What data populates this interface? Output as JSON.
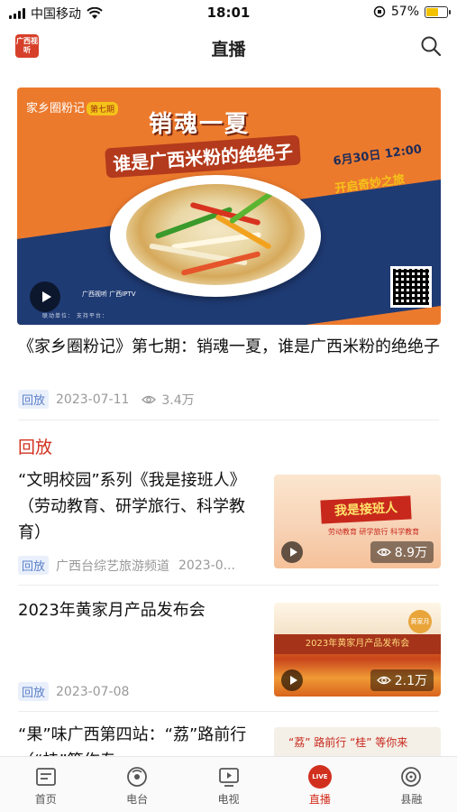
{
  "status_bar": {
    "carrier": "中国移动",
    "time": "18:01",
    "battery_percent": "57%",
    "battery_level": 0.57,
    "battery_color": "#f2c200"
  },
  "header": {
    "title": "直播",
    "logo_text": "广西视听",
    "search_icon": "search-icon"
  },
  "featured": {
    "brand": "家乡圈粉记",
    "episode": "第七期",
    "headline": "销魂一夏",
    "subheadline": "谁是广西米粉的绝绝子",
    "date": "6月30日 12:00",
    "tagline": "开启奇妙之旅",
    "logos": "广西视听  广西IPTV",
    "partners": "联动单位：   支持平台：",
    "title": "《家乡圈粉记》第七期：销魂一夏，谁是广西米粉的绝绝子",
    "badge": "回放",
    "date_published": "2023-07-11",
    "views": "3.4万"
  },
  "section_title": "回放",
  "items": [
    {
      "title": "“文明校园”系列《我是接班人》（劳动教育、研学旅行、科学教育）",
      "badge": "回放",
      "source": "广西台综艺旅游频道",
      "date": "2023-0...",
      "views": "8.9万",
      "thumb_text": "我是接班人",
      "thumb_sub": "劳动教育 研学旅行 科学教育"
    },
    {
      "title": "2023年黄家月产品发布会",
      "badge": "回放",
      "date": "2023-07-08",
      "views": "2.1万",
      "thumb_text": "2023年黄家月产品发布会",
      "thumb_stamp": "黄家月"
    },
    {
      "title": "“果”味广西第四站：“荔”路前行（“桂”等作专",
      "thumb_text": "“荔” 路前行 “桂” 等你来"
    }
  ],
  "tabbar": {
    "tabs": [
      {
        "label": "首页",
        "icon": "home-icon"
      },
      {
        "label": "电台",
        "icon": "radio-icon"
      },
      {
        "label": "电视",
        "icon": "tv-icon"
      },
      {
        "label": "直播",
        "icon": "live-icon",
        "icon_text": "LIVE"
      },
      {
        "label": "县融",
        "icon": "county-icon"
      }
    ],
    "active_color": "#d2301f"
  }
}
